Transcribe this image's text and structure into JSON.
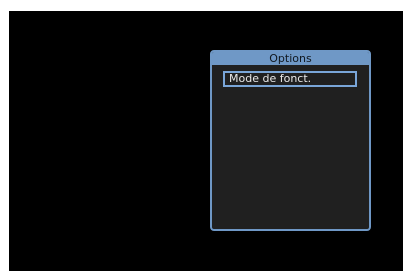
{
  "options_menu": {
    "title": "Options",
    "items": [
      {
        "label": "Mode de fonct.",
        "selected": true
      }
    ]
  },
  "colors": {
    "screen_background": "#000000",
    "panel_accent": "#6f98c6",
    "panel_background": "#202020",
    "selection_border": "#7aa6d8",
    "text": "#e8e8e8"
  }
}
